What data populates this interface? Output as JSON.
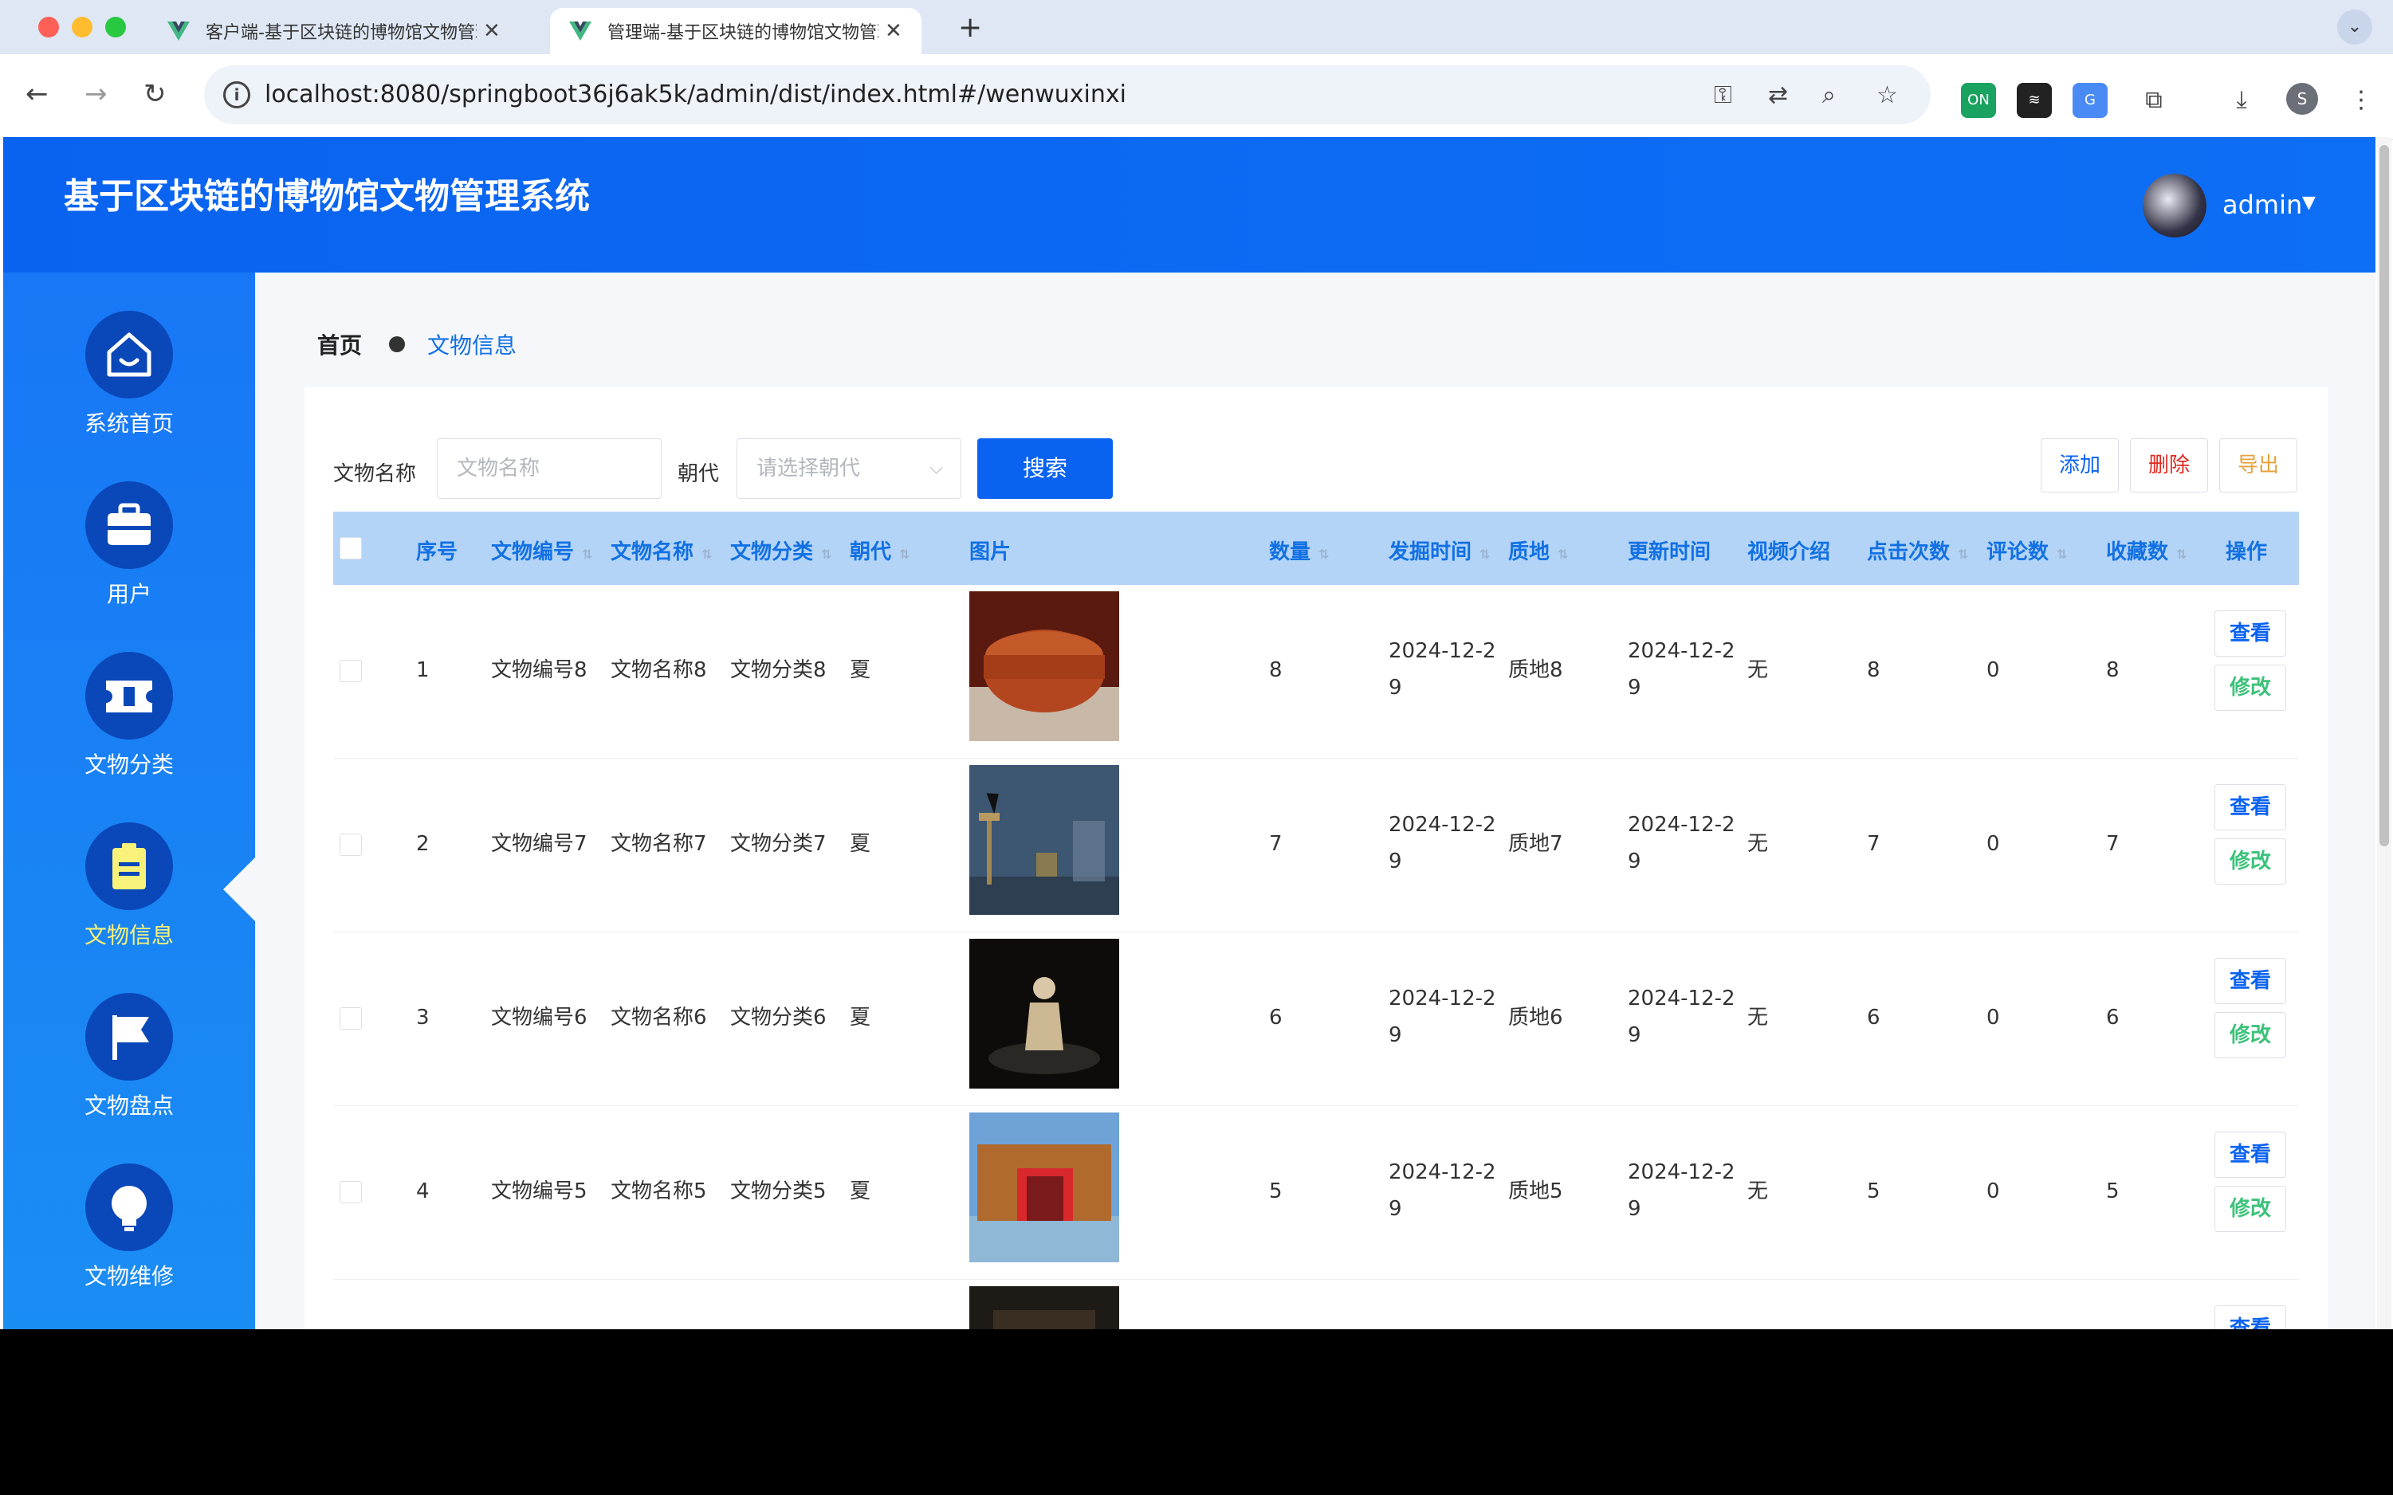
{
  "browser": {
    "tabs": [
      {
        "title": "客户端-基于区块链的博物馆文物管理系统",
        "active": false
      },
      {
        "title": "管理端-基于区块链的博物馆文物管理系统",
        "active": true
      }
    ],
    "url": "localhost:8080/springboot36j6ak5k/admin/dist/index.html#/wenwuxinxi",
    "profile_initial": "S"
  },
  "header": {
    "title": "基于区块链的博物馆文物管理系统",
    "username": "admin"
  },
  "sidebar": {
    "items": [
      {
        "label": "系统首页",
        "icon": "home-icon"
      },
      {
        "label": "用户",
        "icon": "briefcase-icon"
      },
      {
        "label": "文物分类",
        "icon": "ticket-icon"
      },
      {
        "label": "文物信息",
        "icon": "clipboard-icon",
        "active": true
      },
      {
        "label": "文物盘点",
        "icon": "flag-icon"
      },
      {
        "label": "文物维修",
        "icon": "lightbulb-icon"
      }
    ]
  },
  "breadcrumb": {
    "home": "首页",
    "current": "文物信息"
  },
  "search": {
    "name_label": "文物名称",
    "name_placeholder": "文物名称",
    "dynasty_label": "朝代",
    "dynasty_placeholder": "请选择朝代",
    "search_button": "搜索"
  },
  "actions": {
    "add": "添加",
    "delete": "删除",
    "export": "导出"
  },
  "table": {
    "headers": [
      "序号",
      "文物编号",
      "文物名称",
      "文物分类",
      "朝代",
      "图片",
      "数量",
      "发掘时间",
      "质地",
      "更新时间",
      "视频介绍",
      "点击次数",
      "评论数",
      "收藏数",
      "操作"
    ],
    "rows": [
      {
        "index": "1",
        "code": "文物编号8",
        "name": "文物名称8",
        "category": "文物分类8",
        "dynasty": "夏",
        "qty": "8",
        "dig_time_1": "2024-12-2",
        "dig_time_2": "9",
        "material": "质地8",
        "update_1": "2024-12-2",
        "update_2": "9",
        "video": "无",
        "clicks": "8",
        "comments": "0",
        "favorites": "8"
      },
      {
        "index": "2",
        "code": "文物编号7",
        "name": "文物名称7",
        "category": "文物分类7",
        "dynasty": "夏",
        "qty": "7",
        "dig_time_1": "2024-12-2",
        "dig_time_2": "9",
        "material": "质地7",
        "update_1": "2024-12-2",
        "update_2": "9",
        "video": "无",
        "clicks": "7",
        "comments": "0",
        "favorites": "7"
      },
      {
        "index": "3",
        "code": "文物编号6",
        "name": "文物名称6",
        "category": "文物分类6",
        "dynasty": "夏",
        "qty": "6",
        "dig_time_1": "2024-12-2",
        "dig_time_2": "9",
        "material": "质地6",
        "update_1": "2024-12-2",
        "update_2": "9",
        "video": "无",
        "clicks": "6",
        "comments": "0",
        "favorites": "6"
      },
      {
        "index": "4",
        "code": "文物编号5",
        "name": "文物名称5",
        "category": "文物分类5",
        "dynasty": "夏",
        "qty": "5",
        "dig_time_1": "2024-12-2",
        "dig_time_2": "9",
        "material": "质地5",
        "update_1": "2024-12-2",
        "update_2": "9",
        "video": "无",
        "clicks": "5",
        "comments": "0",
        "favorites": "5"
      }
    ],
    "view_button": "查看",
    "edit_button": "修改"
  },
  "colors": {
    "brand": "#0a63f0",
    "header_bg": "#b3d4f7",
    "delete": "#e0281e",
    "export": "#e6a23c",
    "edit": "#3cc27a",
    "active_nav": "#f8f27a"
  }
}
